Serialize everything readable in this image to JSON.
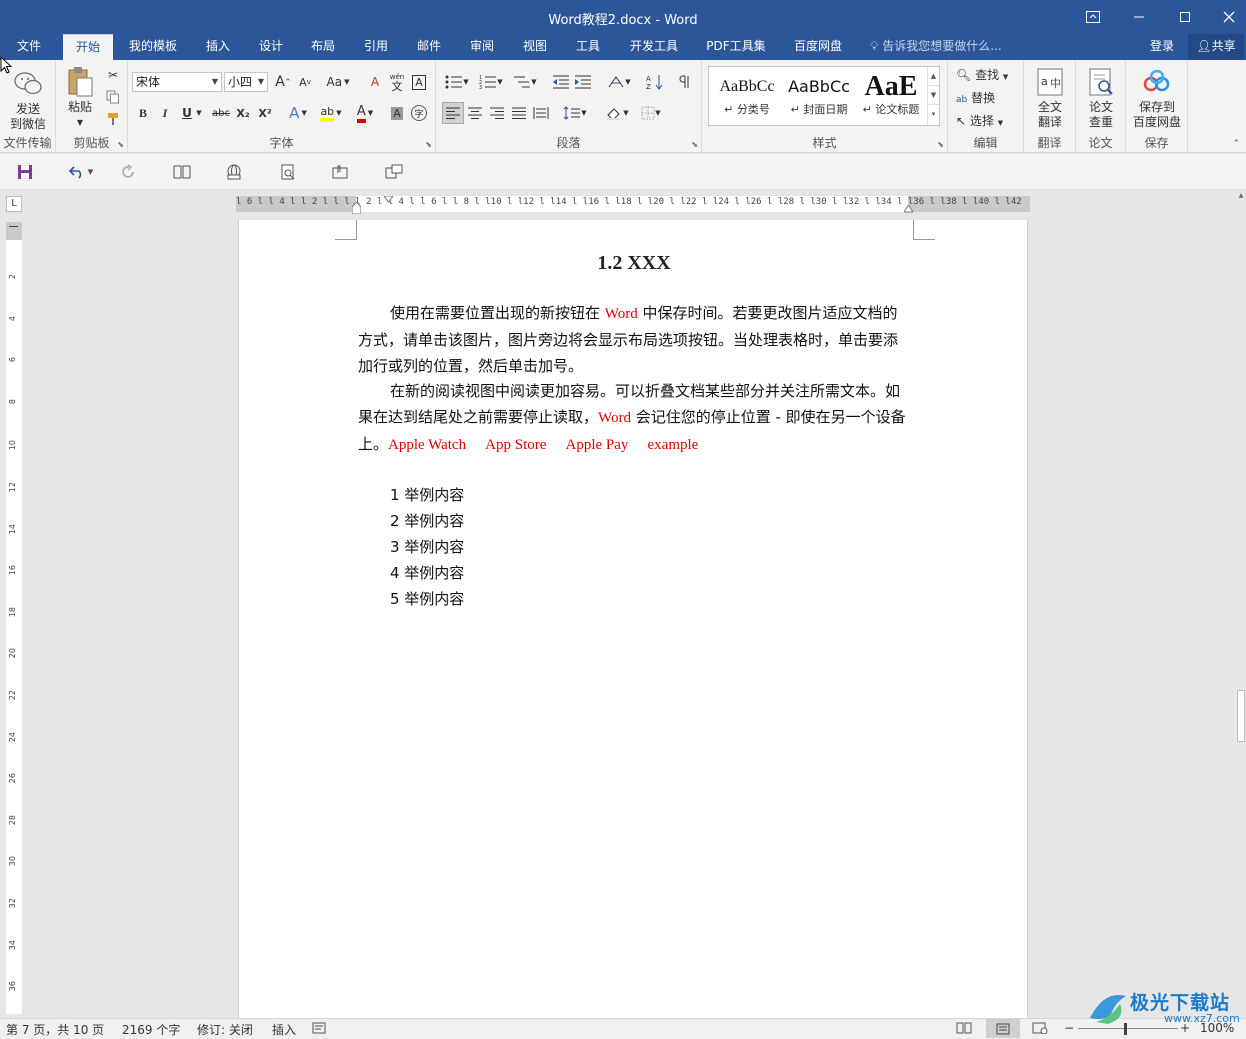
{
  "window": {
    "title": "Word教程2.docx - Word"
  },
  "tabs": [
    {
      "label": "文件",
      "active": false
    },
    {
      "label": "开始",
      "active": true
    },
    {
      "label": "我的模板",
      "active": false
    },
    {
      "label": "插入",
      "active": false
    },
    {
      "label": "设计",
      "active": false
    },
    {
      "label": "布局",
      "active": false
    },
    {
      "label": "引用",
      "active": false
    },
    {
      "label": "邮件",
      "active": false
    },
    {
      "label": "审阅",
      "active": false
    },
    {
      "label": "视图",
      "active": false
    },
    {
      "label": "工具",
      "active": false
    },
    {
      "label": "开发工具",
      "active": false
    },
    {
      "label": "PDF工具集",
      "active": false
    },
    {
      "label": "百度网盘",
      "active": false
    }
  ],
  "tellme": "告诉我您想要做什么...",
  "account": {
    "login": "登录",
    "share": "共享"
  },
  "ribbon": {
    "wechat": {
      "label1": "发送",
      "label2": "到微信",
      "group": "文件传输"
    },
    "clipboard": {
      "paste": "粘贴",
      "group": "剪贴板"
    },
    "font": {
      "font_name": "宋体",
      "font_size": "小四",
      "grow": "A",
      "shrink": "A",
      "case": "Aa",
      "clear": "A",
      "phonetic_top": "wén",
      "phonetic_bottom": "文",
      "border_char": "A",
      "bold": "B",
      "italic": "I",
      "underline": "U",
      "strike": "abc",
      "sub": "X₂",
      "sup": "X²",
      "effects": "A",
      "highlight": "ab",
      "color": "A",
      "shade": "A",
      "enclose": "字",
      "group": "字体"
    },
    "paragraph": {
      "group": "段落"
    },
    "styles": {
      "items": [
        {
          "preview": "AaBbCc",
          "name": "分类号"
        },
        {
          "preview": "AaBbCc",
          "name": "封面日期"
        },
        {
          "preview": "AaE",
          "name": "论文标题"
        }
      ],
      "group": "样式"
    },
    "editing": {
      "find": "查找",
      "replace": "替换",
      "select": "选择",
      "group": "编辑"
    },
    "translate": {
      "label1": "全文",
      "label2": "翻译",
      "group": "翻译"
    },
    "paper": {
      "label1": "论文",
      "label2": "查重",
      "group": "论文"
    },
    "save": {
      "label1": "保存到",
      "label2": "百度网盘",
      "group": "保存"
    }
  },
  "ruler": {
    "numbers": "l 6 l  l 4 l  l 2 l  l  l  l 2 l  l 4 l  l 6 l  l 8 l  l10 l  l12 l  l14 l  l16 l  l18 l  l20 l  l22 l  l24 l  l26 l  l28 l  l30 l  l32 l  l34 l  l36 l  l38 l  l40 l  l42"
  },
  "vruler": {
    "numbers": [
      "2",
      "4",
      "6",
      "8",
      "10",
      "12",
      "14",
      "16",
      "18",
      "20",
      "22",
      "24",
      "26",
      "28",
      "30",
      "32",
      "34",
      "36"
    ]
  },
  "document": {
    "title": "1.2 XXX",
    "para1": {
      "t1": "使用在需要位置出现的新按钮在 ",
      "w1": "Word",
      "t2": " 中保存时间。若要更改图片适应文档的方式，请单击该图片，图片旁边将会显示布局选项按钮。当处理表格时，单击要添加行或列的位置，然后单击加号。"
    },
    "para2": {
      "t1": "在新的阅读视图中阅读更加容易。可以折叠文档某些部分并关注所需文本。如果在达到结尾处之前需要停止读取，",
      "w1": "Word",
      "t2": " 会记住您的停止位置 - 即使在另一个设备上。",
      "w2": "Apple Watch",
      "w3": "App Store",
      "w4": "Apple Pay",
      "w5": "example"
    },
    "list": [
      "1 举例内容",
      "2 举例内容",
      "3 举例内容",
      "4 举例内容",
      "5 举例内容"
    ]
  },
  "status": {
    "page": "第 7 页，共 10 页",
    "words": "2169 个字",
    "track": "修订: 关闭",
    "mode": "插入",
    "zoom": "100%"
  },
  "watermark": {
    "text": "极光下载站",
    "url": "www.xz7.com"
  },
  "colors": {
    "brand": "#2b579a",
    "red_text": "#e00000"
  }
}
